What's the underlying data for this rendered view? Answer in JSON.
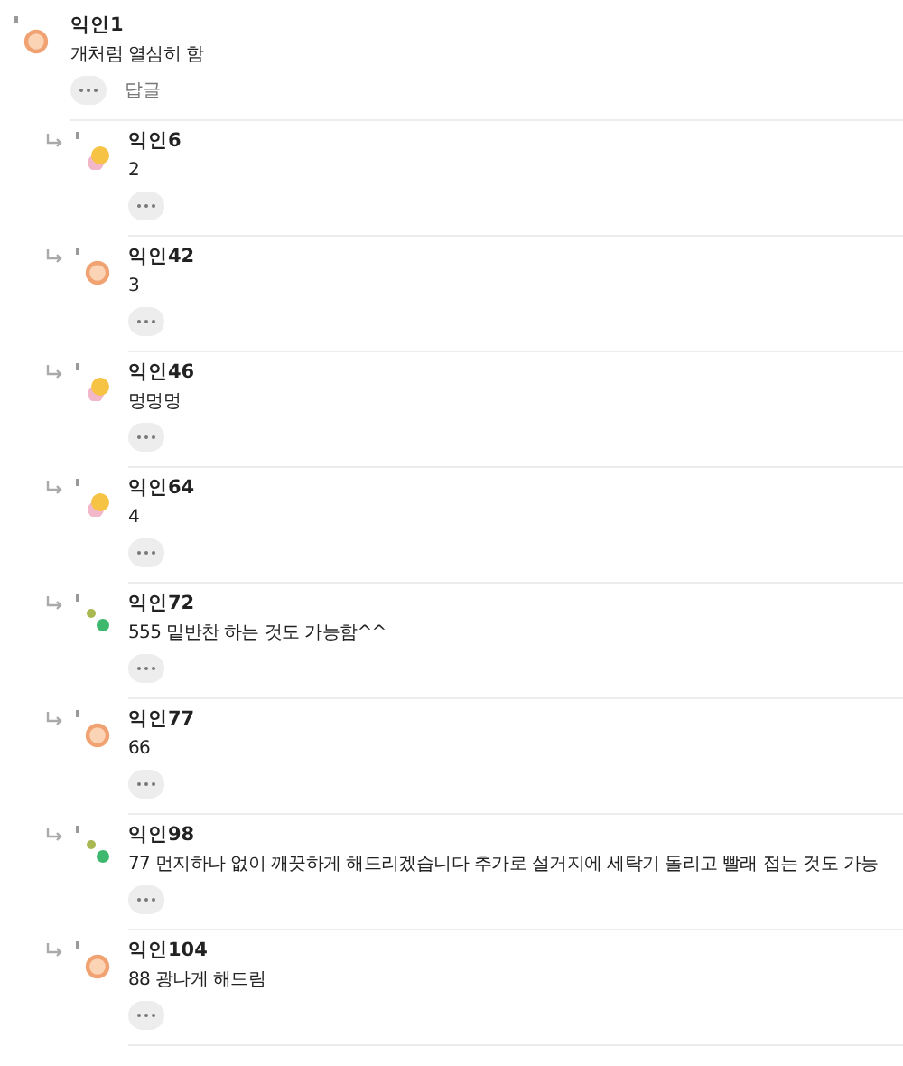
{
  "comment": {
    "author": "익인1",
    "kind": "ring",
    "text": "개처럼 열심히 함",
    "reply_label": "답글"
  },
  "replies": [
    {
      "author": "익인6",
      "kind": "blob",
      "text": "2"
    },
    {
      "author": "익인42",
      "kind": "ring",
      "text": "3"
    },
    {
      "author": "익인46",
      "kind": "blob",
      "text": "멍멍멍"
    },
    {
      "author": "익인64",
      "kind": "blob",
      "text": "4"
    },
    {
      "author": "익인72",
      "kind": "dots",
      "text": "555 밑반찬 하는 것도 가능함^^"
    },
    {
      "author": "익인77",
      "kind": "ring",
      "text": "66"
    },
    {
      "author": "익인98",
      "kind": "dots",
      "text": "77 먼지하나 없이 깨끗하게 해드리겠습니다 추가로 설거지에 세탁기 돌리고 빨래 접는 것도 가능"
    },
    {
      "author": "익인104",
      "kind": "ring",
      "text": "88 광나게 해드림"
    }
  ]
}
